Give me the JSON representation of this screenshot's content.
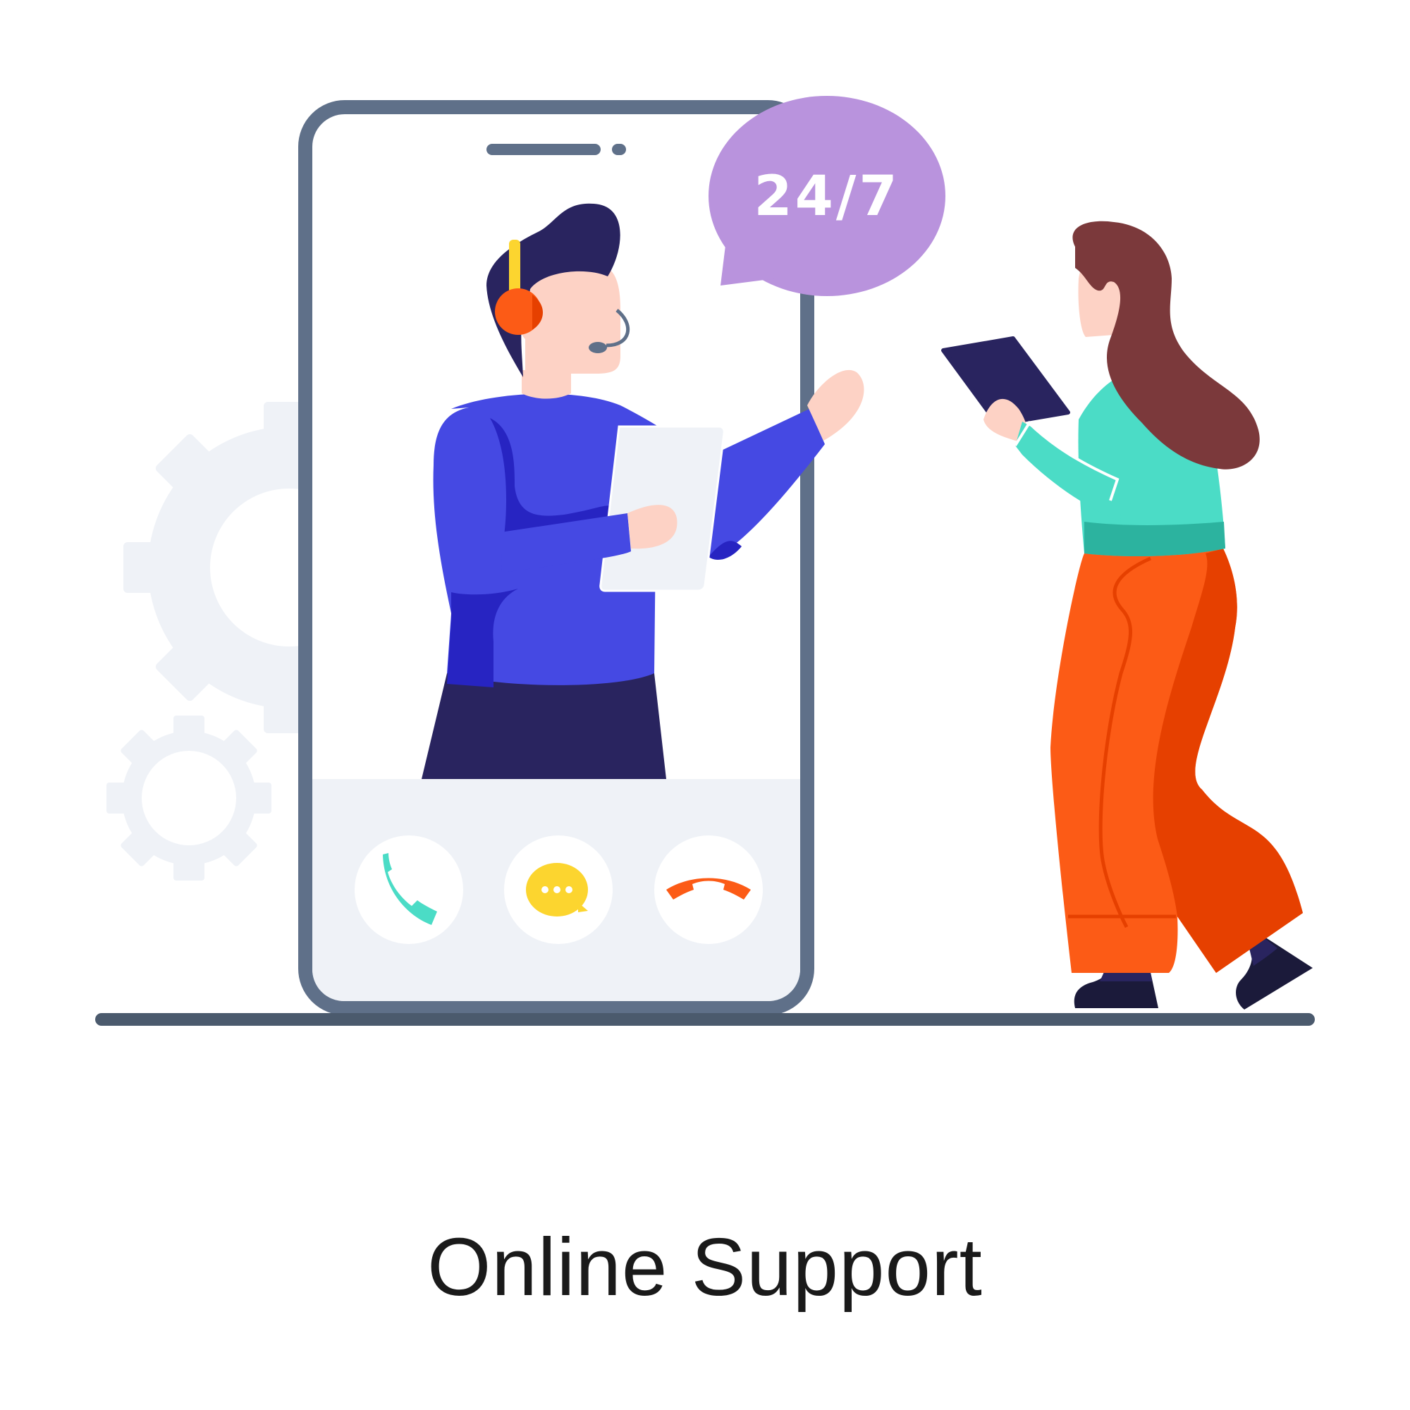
{
  "illustration": {
    "bubble_text": "24/7",
    "caption": "Online Support",
    "icons": [
      "gear-icon",
      "phone-call-icon",
      "chat-icon",
      "hang-up-icon"
    ],
    "colors": {
      "phone_frame": "#5f7089",
      "screen_panel": "#eff2f7",
      "bubble": "#b993dd",
      "agent_shirt": "#4549e3",
      "agent_hair": "#29245f",
      "headset": "#fc5b16",
      "woman_top": "#4bdcc6",
      "woman_pants": "#fc5b16",
      "woman_hair": "#7b393b",
      "skin": "#fdd2c5",
      "ground": "#4b5a6d",
      "gear": "#eff2f7"
    }
  }
}
